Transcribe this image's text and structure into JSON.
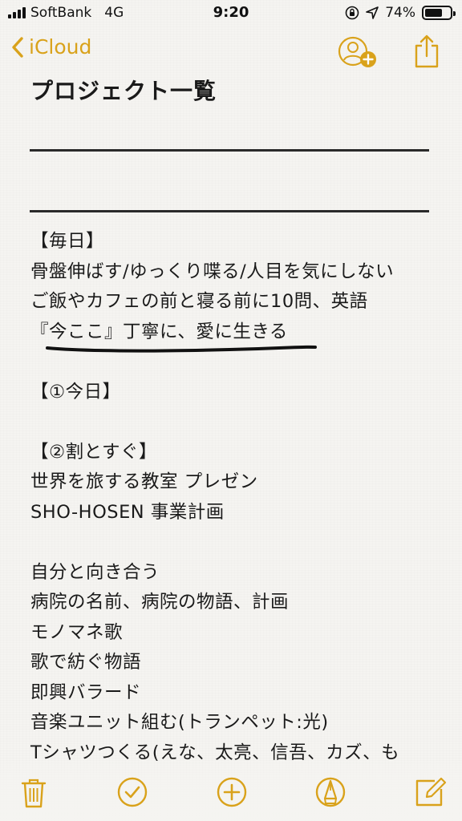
{
  "status_bar": {
    "carrier": "SoftBank",
    "network": "4G",
    "time": "9:20",
    "battery": "74%",
    "battery_level": 0.74
  },
  "nav": {
    "back_label": "iCloud"
  },
  "note": {
    "title": "プロジェクト一覧",
    "lines": [
      "【毎日】",
      "骨盤伸ばす/ゆっくり喋る/人目を気にしない",
      "ご飯やカフェの前と寝る前に10問、英語",
      "『今ここ』丁寧に、愛に生きる",
      "",
      "【①今日】",
      "",
      "【②割とすぐ】",
      "世界を旅する教室 プレゼン",
      "SHO-HOSEN 事業計画",
      "",
      "自分と向き合う",
      "病院の名前、病院の物語、計画",
      "モノマネ歌",
      "歌で紡ぐ物語",
      "即興バラード",
      "音楽ユニット組む(トランペット:光)",
      "Tシャツつくる(えな、太亮、信吾、カズ、も"
    ]
  },
  "colors": {
    "accent": "#d9a21b",
    "paper": "#f5f4f1",
    "ink": "#1a1a1a"
  },
  "icons": {
    "back": "chevron-left-icon",
    "add_person": "add-person-icon",
    "share": "share-icon",
    "trash": "trash-icon",
    "checklist": "checklist-icon",
    "add": "plus-circle-icon",
    "markup": "pen-tip-icon",
    "compose": "compose-icon"
  }
}
